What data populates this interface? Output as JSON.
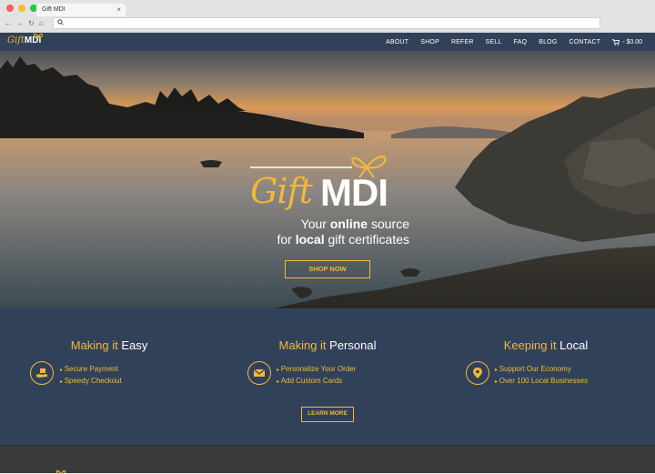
{
  "browser": {
    "tab_title": "Gift MDI",
    "tab_close": "×",
    "url": ""
  },
  "header": {
    "logo_gift": "Gift",
    "logo_mdi": "MDI",
    "menu": [
      "ABOUT",
      "SHOP",
      "REFER",
      "SELL",
      "FAQ",
      "BLOG",
      "CONTACT"
    ],
    "cart_total": "- $0.00"
  },
  "hero": {
    "logo_gift": "Gift",
    "logo_mdi": "MDI",
    "tagline_1_pre": "Your ",
    "tagline_1_bold": "online",
    "tagline_1_post": " source",
    "tagline_2_pre": "for ",
    "tagline_2_bold": "local",
    "tagline_2_post": " gift certificates",
    "shop_button": "SHOP NOW"
  },
  "features": [
    {
      "title_pre": "Making it ",
      "title_strong": "Easy",
      "icon": "hand-gift-icon",
      "items": [
        "Secure Payment",
        "Speedy Checkout"
      ]
    },
    {
      "title_pre": "Making it ",
      "title_strong": "Personal",
      "icon": "envelope-card-icon",
      "items": [
        "Personalize Your Order",
        "Add Custom Cards"
      ]
    },
    {
      "title_pre": "Keeping it ",
      "title_strong": "Local",
      "icon": "map-pin-icon",
      "items": [
        "Support Our Economy",
        "Over 100 Local Businesses"
      ]
    }
  ],
  "learn_more": "LEARN MORE",
  "colors": {
    "accent": "#f2b83a",
    "navy": "#32415a",
    "footer": "#3a3a3a"
  }
}
